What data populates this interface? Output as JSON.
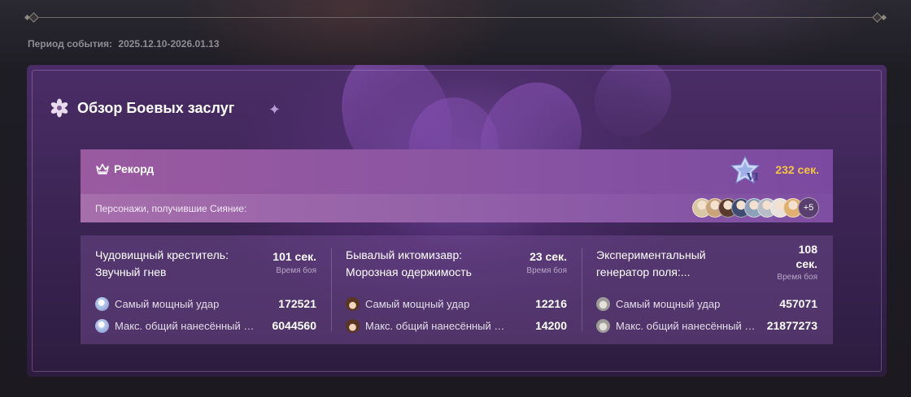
{
  "period": {
    "label": "Период события:",
    "value": "2025.12.10-2026.01.13"
  },
  "panel": {
    "title": "Обзор Боевых заслуг",
    "title_icon": "flower-emblem-icon"
  },
  "record": {
    "label": "Рекорд",
    "label_icon": "crown-icon",
    "badge_icon": "difficulty-vi-badge-icon",
    "badge_text": "VI",
    "time": "232 сек.",
    "time_color": "#f5c542",
    "shine_label": "Персонажи, получившие Сияние:",
    "avatars": [
      {
        "name": "character-avatar-1",
        "color": "#d9c7a4"
      },
      {
        "name": "character-avatar-2",
        "color": "#c9a47a"
      },
      {
        "name": "character-avatar-3",
        "color": "#5a3a2e"
      },
      {
        "name": "character-avatar-4",
        "color": "#3e4c72"
      },
      {
        "name": "character-avatar-5",
        "color": "#8da0b8"
      },
      {
        "name": "character-avatar-6",
        "color": "#b7bcc6"
      },
      {
        "name": "character-avatar-7",
        "color": "#e8e1dc"
      },
      {
        "name": "character-avatar-8",
        "color": "#e0b070"
      }
    ],
    "more": "+5"
  },
  "bosses": [
    {
      "name": "Чудовищный креститель: Звучный гнев",
      "time": "101 сек.",
      "time_label": "Время боя",
      "stats": [
        {
          "label": "Самый мощный удар",
          "value": "172521",
          "icon": "character-icon-crystal"
        },
        {
          "label": "Макс. общий нанесённый урон",
          "value": "6044560",
          "icon": "character-icon-crystal"
        }
      ]
    },
    {
      "name": "Бывалый иктомизавр: Морозная одержимость",
      "time": "23 сек.",
      "time_label": "Время боя",
      "stats": [
        {
          "label": "Самый мощный удар",
          "value": "12216",
          "icon": "character-icon-brown-hair"
        },
        {
          "label": "Макс. общий нанесённый урон",
          "value": "14200",
          "icon": "character-icon-brown-hair"
        }
      ]
    },
    {
      "name": "Экспериментальный генератор поля:...",
      "time": "108 сек.",
      "time_label": "Время боя",
      "stats": [
        {
          "label": "Самый мощный удар",
          "value": "457071",
          "icon": "character-icon-white-hair"
        },
        {
          "label": "Макс. общий нанесённый урон",
          "value": "21877273",
          "icon": "character-icon-white-hair"
        }
      ]
    }
  ]
}
